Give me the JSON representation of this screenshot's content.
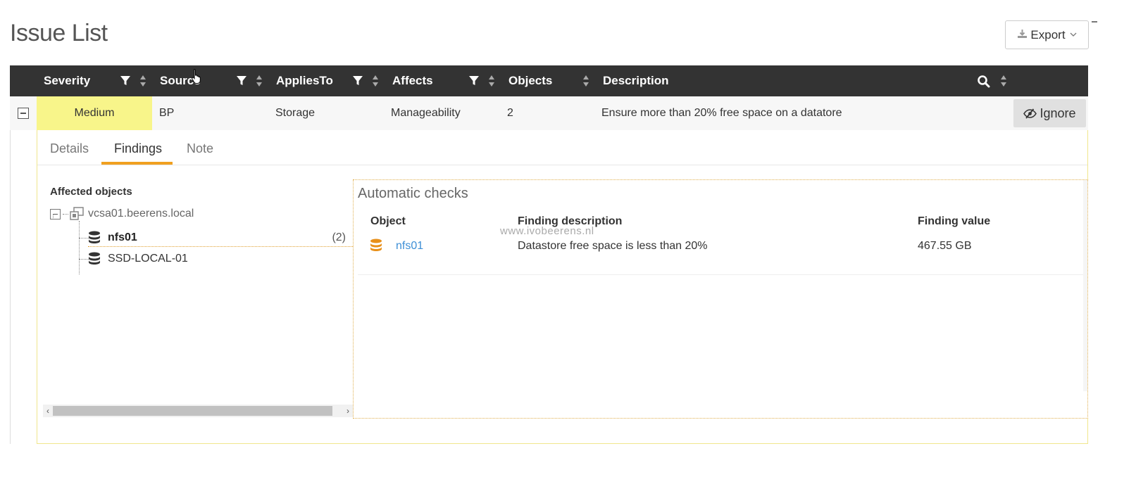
{
  "page": {
    "title": "Issue List"
  },
  "toolbar": {
    "export_label": "Export"
  },
  "table": {
    "headers": {
      "severity": "Severity",
      "source": "Source",
      "applies_to": "AppliesTo",
      "affects": "Affects",
      "objects": "Objects",
      "description": "Description"
    },
    "row": {
      "severity": "Medium",
      "source": "BP",
      "applies_to": "Storage",
      "affects": "Manageability",
      "objects": "2",
      "description": "Ensure more than 20% free space on a datatore",
      "ignore_label": "Ignore"
    }
  },
  "tabs": [
    {
      "label": "Details"
    },
    {
      "label": "Findings",
      "active": true
    },
    {
      "label": "Note"
    }
  ],
  "affected": {
    "title": "Affected objects",
    "root": "vcsa01.beerens.local",
    "items": [
      {
        "label": "nfs01",
        "count": "(2)",
        "selected": true
      },
      {
        "label": "SSD-LOCAL-01",
        "count": ""
      }
    ]
  },
  "checks": {
    "title": "Automatic checks",
    "headers": {
      "object": "Object",
      "description": "Finding description",
      "value": "Finding value"
    },
    "rows": [
      {
        "object": "nfs01",
        "description": "Datastore free space is less than 20%",
        "value": "467.55 GB"
      }
    ]
  },
  "watermark": "www.ivobeerens.nl",
  "colors": {
    "severity_medium": "#f8f58a",
    "header_bg": "#333333",
    "accent": "#f0a020",
    "link": "#3d8fd6",
    "db_orange": "#e8901a"
  },
  "icons": [
    "download-icon",
    "chevron-down-icon",
    "filter-icon",
    "sort-icon",
    "search-icon",
    "eye-slash-icon",
    "vcenter-icon",
    "database-icon"
  ]
}
